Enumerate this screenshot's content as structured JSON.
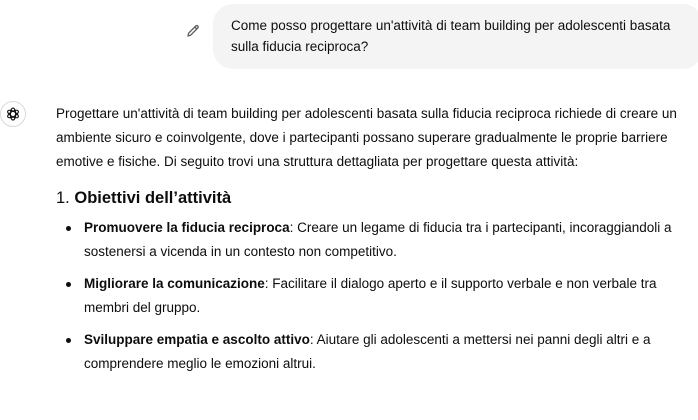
{
  "conversation": {
    "user_message": "Come posso progettare un'attività di team building per adolescenti basata sulla fiducia reciproca?",
    "assistant": {
      "intro": "Progettare un'attività di team building per adolescenti basata sulla fiducia reciproca richiede di creare un ambiente sicuro e coinvolgente, dove i partecipanti possano superare gradualmente le proprie barriere emotive e fisiche. Di seguito trovi una struttura dettagliata per progettare questa attività:",
      "section": {
        "number": "1.",
        "title": "Obiettivi dell’attività"
      },
      "bullets": [
        {
          "label": "Promuovere la fiducia reciproca",
          "text": ": Creare un legame di fiducia tra i partecipanti, incoraggiandoli a sostenersi a vicenda in un contesto non competitivo."
        },
        {
          "label": "Migliorare la comunicazione",
          "text": ": Facilitare il dialogo aperto e il supporto verbale e non verbale tra membri del gruppo."
        },
        {
          "label": "Sviluppare empatia e ascolto attivo",
          "text": ": Aiutare gli adolescenti a mettersi nei panni degli altri e a comprendere meglio le emozioni altrui."
        }
      ]
    }
  },
  "icons": {
    "edit": "pencil-icon",
    "assistant_avatar": "assistant-logo-icon"
  }
}
